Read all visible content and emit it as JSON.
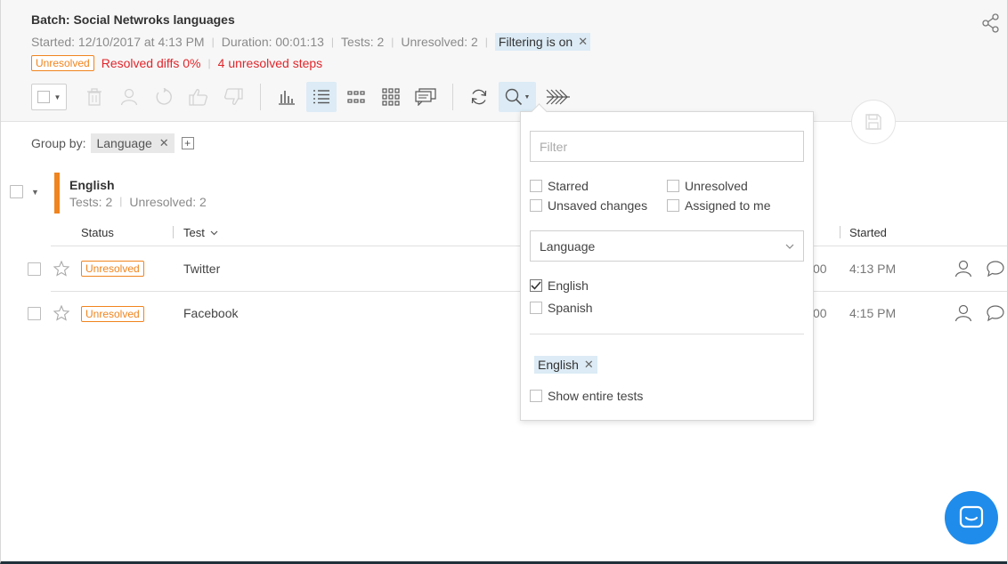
{
  "header": {
    "title": "Batch: Social Netwroks languages",
    "started": "Started: 12/10/2017 at 4:13 PM",
    "duration": "Duration: 00:01:13",
    "tests": "Tests: 2",
    "unresolved": "Unresolved: 2",
    "filtering_chip": "Filtering is on",
    "status_badge": "Unresolved",
    "resolved_diffs": "Resolved diffs 0%",
    "unresolved_steps": "4 unresolved steps"
  },
  "toolbar": {
    "icons": [
      "select-all-checkbox",
      "trash-icon",
      "user-icon",
      "undo-icon",
      "thumbs-up-icon",
      "thumbs-down-icon",
      "bar-chart-icon",
      "list-view-icon",
      "grid-small-icon",
      "grid-large-icon",
      "comments-icon",
      "refresh-icon",
      "search-icon",
      "collapse-arrows-icon"
    ]
  },
  "groupby": {
    "label": "Group by:",
    "chip": "Language"
  },
  "group": {
    "name": "English",
    "tests": "Tests: 2",
    "unresolved": "Unresolved: 2",
    "accent_color": "#f0841e"
  },
  "table": {
    "columns": {
      "status": "Status",
      "test": "Test",
      "started": "Started"
    },
    "rows": [
      {
        "status": "Unresolved",
        "test": "Twitter",
        "duration_tail": "00",
        "started": "4:13 PM"
      },
      {
        "status": "Unresolved",
        "test": "Facebook",
        "duration_tail": "00",
        "started": "4:15 PM"
      }
    ]
  },
  "filter_panel": {
    "placeholder": "Filter",
    "options": {
      "starred": "Starred",
      "unresolved": "Unresolved",
      "unsaved": "Unsaved changes",
      "assigned": "Assigned to me"
    },
    "group_select": "Language",
    "languages": [
      {
        "label": "English",
        "checked": true
      },
      {
        "label": "Spanish",
        "checked": false
      }
    ],
    "selected_chip": "English",
    "show_entire": "Show entire tests"
  },
  "colors": {
    "accent": "#1f8ceb",
    "warning": "#f0841e",
    "error": "#e0262b",
    "highlight": "#dcebf5"
  }
}
